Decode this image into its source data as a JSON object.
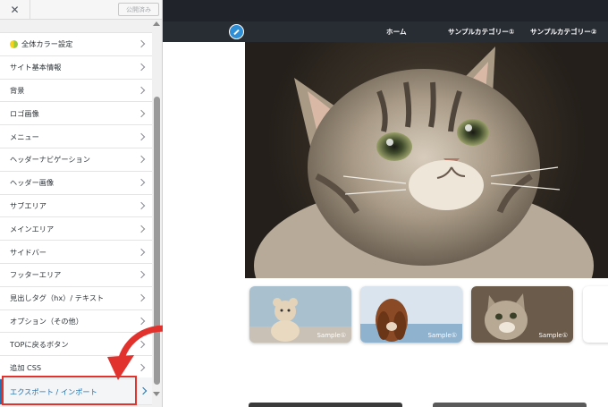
{
  "header": {
    "close_glyph": "✕",
    "publish_label": "公開済み"
  },
  "menu": {
    "items": [
      {
        "label": "全体カラー設定",
        "icon": "color-palette-icon"
      },
      {
        "label": "サイト基本情報"
      },
      {
        "label": "背景"
      },
      {
        "label": "ロゴ画像"
      },
      {
        "label": "メニュー"
      },
      {
        "label": "ヘッダーナビゲーション"
      },
      {
        "label": "ヘッダー画像"
      },
      {
        "label": "サブエリア"
      },
      {
        "label": "メインエリア"
      },
      {
        "label": "サイドバー"
      },
      {
        "label": "フッターエリア"
      },
      {
        "label": "見出しタグ（hx）/ テキスト"
      },
      {
        "label": "オプション（その他）"
      },
      {
        "label": "TOPに戻るボタン"
      },
      {
        "label": "追加 CSS"
      },
      {
        "label": "エクスポート / インポート",
        "active": true
      }
    ]
  },
  "preview": {
    "nav": {
      "items": [
        "ホーム",
        "サンプルカテゴリー①",
        "サンプルカテゴリー②"
      ]
    },
    "cards": [
      {
        "caption": "Sample①"
      },
      {
        "caption": "Sample①"
      },
      {
        "caption": "Sample①"
      }
    ]
  },
  "colors": {
    "accent_blue": "#2271b1",
    "highlight_red": "#e2322e",
    "nav_dark": "#282c33"
  }
}
